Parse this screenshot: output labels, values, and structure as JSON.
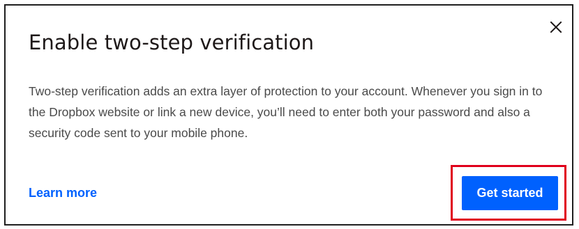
{
  "dialog": {
    "title": "Enable two-step verification",
    "description": "Two-step verification adds an extra layer of protection to your account. Whenever you sign in to the Dropbox website or link a new device, you’ll need to enter both your password and also a security code sent to your mobile phone.",
    "close_icon": "close-icon",
    "learn_more_label": "Learn more",
    "primary_button_label": "Get started"
  },
  "colors": {
    "accent": "#0061fe",
    "title_text": "#1e1919",
    "body_text": "#4a4a4a",
    "highlight": "#e0001b"
  }
}
